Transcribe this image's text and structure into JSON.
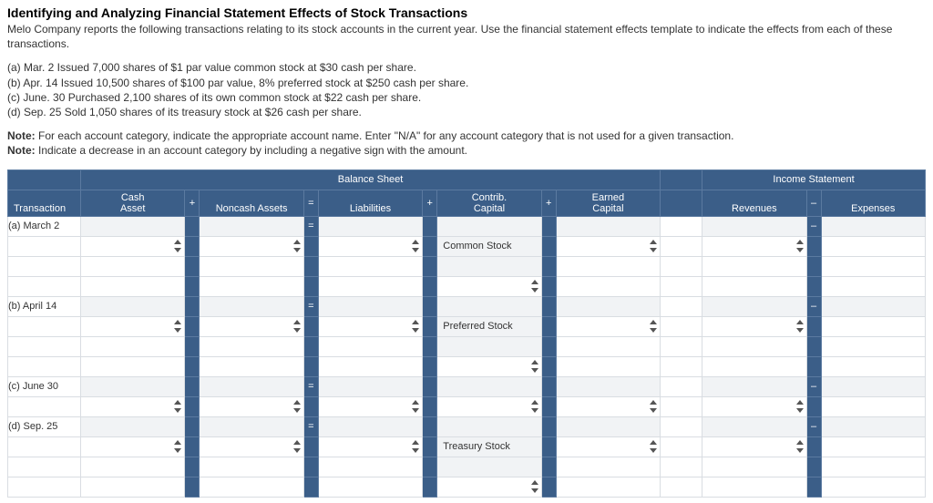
{
  "title": "Identifying and Analyzing Financial Statement Effects of Stock Transactions",
  "intro": "Melo Company reports the following transactions relating to its stock accounts in the current year. Use the financial statement effects template to indicate the effects from each of these transactions.",
  "transactions": {
    "a": "(a) Mar. 2 Issued 7,000 shares of $1 par value common stock at $30 cash per share.",
    "b": "(b) Apr. 14 Issued 10,500 shares of $100 par value, 8% preferred stock at $250 cash per share.",
    "c": "(c) June. 30 Purchased 2,100 shares of its own common stock at $22 cash per share.",
    "d": "(d) Sep. 25 Sold 1,050 shares of its treasury stock at $26 cash per share."
  },
  "note1_pre": "Note:",
  "note1": "For each account category, indicate the appropriate account name. Enter \"N/A\" for any account category that is not used for a given transaction.",
  "note2_pre": "Note:",
  "note2": "Indicate a decrease in an account category by including a negative sign with the amount.",
  "headers": {
    "group_bs": "Balance Sheet",
    "group_is": "Income Statement",
    "transaction": "Transaction",
    "cash_asset_l1": "Cash",
    "cash_asset_l2": "Asset",
    "noncash": "Noncash Assets",
    "liabilities": "Liabilities",
    "contrib_l1": "Contrib.",
    "contrib_l2": "Capital",
    "earned_l1": "Earned",
    "earned_l2": "Capital",
    "revenues": "Revenues",
    "expenses": "Expenses",
    "op_plus": "+",
    "op_eq": "=",
    "op_minus": "–"
  },
  "rows": {
    "a_label": "(a) March 2",
    "a_contrib": "Common Stock",
    "b_label": "(b) April 14",
    "b_contrib": "Preferred Stock",
    "c_label": "(c) June 30",
    "d_label": "(d) Sep. 25",
    "d_contrib": "Treasury Stock"
  }
}
